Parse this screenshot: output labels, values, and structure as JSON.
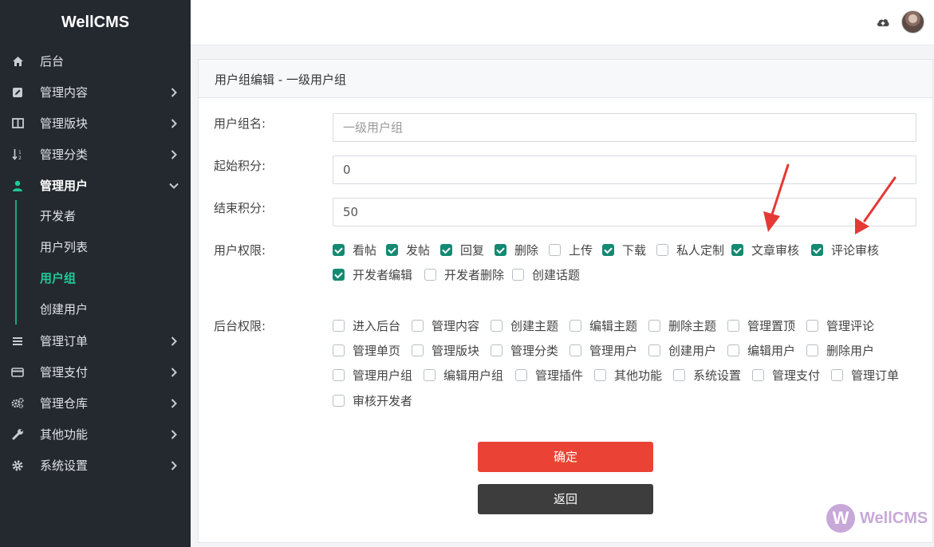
{
  "brand": "WellCMS",
  "sidebar": {
    "items": [
      {
        "label": "后台",
        "icon": "home-icon"
      },
      {
        "label": "管理内容",
        "icon": "edit-icon"
      },
      {
        "label": "管理版块",
        "icon": "columns-icon"
      },
      {
        "label": "管理分类",
        "icon": "sort-icon"
      },
      {
        "label": "管理用户",
        "icon": "user-icon"
      },
      {
        "label": "管理订单",
        "icon": "list-icon"
      },
      {
        "label": "管理支付",
        "icon": "credit-card-icon"
      },
      {
        "label": "管理仓库",
        "icon": "gears-icon"
      },
      {
        "label": "其他功能",
        "icon": "wrench-icon"
      },
      {
        "label": "系统设置",
        "icon": "gear-icon"
      }
    ],
    "sub_items": [
      "开发者",
      "用户列表",
      "用户组",
      "创建用户"
    ],
    "active_item": "管理用户",
    "active_sub_item": "用户组"
  },
  "topbar": {
    "icons": [
      "cloud-upload-icon",
      "avatar"
    ]
  },
  "card": {
    "title": "用户组编辑 - 一级用户组"
  },
  "form": {
    "name_label": "用户组名:",
    "name_placeholder": "一级用户组",
    "start_label": "起始积分:",
    "start_value": "0",
    "end_label": "结束积分:",
    "end_value": "50",
    "perm_label": "用户权限:",
    "permissions": [
      {
        "label": "看帖",
        "checked": true
      },
      {
        "label": "发帖",
        "checked": true
      },
      {
        "label": "回复",
        "checked": true
      },
      {
        "label": "删除",
        "checked": true
      },
      {
        "label": "上传",
        "checked": false
      },
      {
        "label": "下载",
        "checked": true
      },
      {
        "label": "私人定制",
        "checked": false
      },
      {
        "label": "文章审核",
        "checked": true
      },
      {
        "label": "评论审核",
        "checked": true
      },
      {
        "label": "开发者编辑",
        "checked": true
      },
      {
        "label": "开发者删除",
        "checked": false
      },
      {
        "label": "创建话题",
        "checked": false
      }
    ],
    "admin_label": "后台权限:",
    "admin_permissions": [
      {
        "label": "进入后台",
        "checked": false
      },
      {
        "label": "管理内容",
        "checked": false
      },
      {
        "label": "创建主题",
        "checked": false
      },
      {
        "label": "编辑主题",
        "checked": false
      },
      {
        "label": "删除主题",
        "checked": false
      },
      {
        "label": "管理置顶",
        "checked": false
      },
      {
        "label": "管理评论",
        "checked": false
      },
      {
        "label": "管理单页",
        "checked": false
      },
      {
        "label": "管理版块",
        "checked": false
      },
      {
        "label": "管理分类",
        "checked": false
      },
      {
        "label": "管理用户",
        "checked": false
      },
      {
        "label": "创建用户",
        "checked": false
      },
      {
        "label": "编辑用户",
        "checked": false
      },
      {
        "label": "删除用户",
        "checked": false
      },
      {
        "label": "管理用户组",
        "checked": false
      },
      {
        "label": "编辑用户组",
        "checked": false
      },
      {
        "label": "管理插件",
        "checked": false
      },
      {
        "label": "其他功能",
        "checked": false
      },
      {
        "label": "系统设置",
        "checked": false
      },
      {
        "label": "管理支付",
        "checked": false
      },
      {
        "label": "管理订单",
        "checked": false
      },
      {
        "label": "审核开发者",
        "checked": false
      }
    ],
    "submit_label": "确定",
    "back_label": "返回"
  },
  "watermark": {
    "logo_letter": "W",
    "text": "WellCMS"
  },
  "colors": {
    "accent": "#138a72",
    "danger": "#ea4335",
    "sidebar_bg": "#24292f",
    "annotation_arrow": "#e53935"
  }
}
